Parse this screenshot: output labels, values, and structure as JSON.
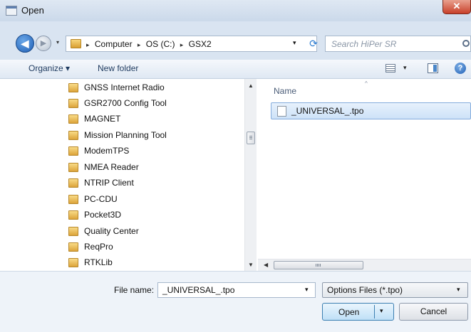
{
  "window": {
    "title": "Open",
    "close_glyph": "✕"
  },
  "navigation": {
    "back_glyph": "◀",
    "forward_glyph": "▶",
    "recent_glyph": "▾",
    "breadcrumbs": [
      "Computer",
      "OS (C:)",
      "GSX2"
    ],
    "breadcrumb_separator": "▸",
    "address_dropdown_glyph": "▾",
    "refresh_glyph": "⟳"
  },
  "search": {
    "placeholder": "Search HiPer SR"
  },
  "toolbar": {
    "organize_label": "Organize ▾",
    "new_folder_label": "New folder",
    "view_dropdown_glyph": "▾",
    "help_glyph": "?"
  },
  "nav_pane": {
    "items": [
      "GNSS Internet Radio",
      "GSR2700 Config Tool",
      "MAGNET",
      "Mission Planning Tool",
      "ModemTPS",
      "NMEA Reader",
      "NTRIP Client",
      "PC-CDU",
      "Pocket3D",
      "Quality Center",
      "ReqPro",
      "RTKLib"
    ],
    "scroll_up_glyph": "▲",
    "scroll_down_glyph": "▼"
  },
  "file_list": {
    "column_name": "Name",
    "sort_glyph": "^",
    "files": [
      "_UNIVERSAL_.tpo"
    ],
    "scroll_left_glyph": "◀"
  },
  "footer": {
    "file_name_label": "File name:",
    "file_name_value": "_UNIVERSAL_.tpo",
    "file_name_dropdown_glyph": "▾",
    "file_type_value": "Options Files (*.tpo)",
    "file_type_dropdown_glyph": "▾",
    "open_label": "Open",
    "open_dropdown_glyph": "▾",
    "cancel_label": "Cancel"
  }
}
